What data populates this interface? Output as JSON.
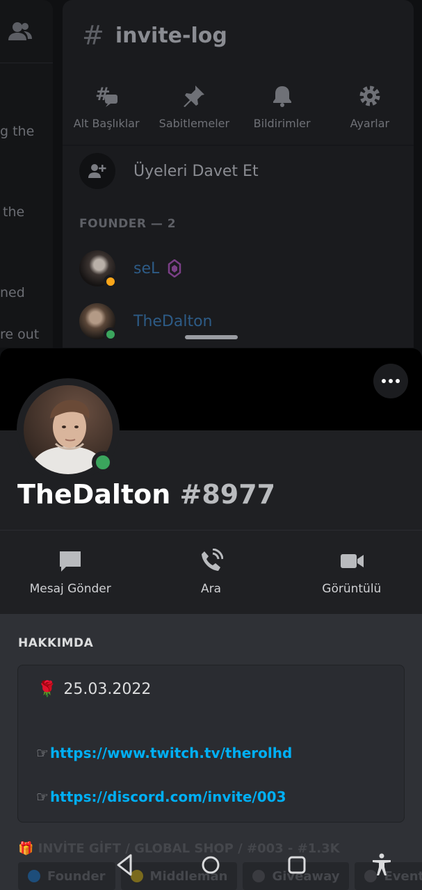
{
  "background": {
    "channel": {
      "name": "invite-log"
    },
    "tools": [
      {
        "icon": "threads-icon",
        "label": "Alt Başlıklar"
      },
      {
        "icon": "pin-icon",
        "label": "Sabitlemeler"
      },
      {
        "icon": "bell-icon",
        "label": "Bildirimler"
      },
      {
        "icon": "gear-icon",
        "label": "Ayarlar"
      }
    ],
    "invite_label": "Üyeleri Davet Et",
    "role_header": "FOUNDER — 2",
    "members": [
      {
        "name": "seL",
        "status_color": "#faa61a",
        "badge": "nitro-badge-icon"
      },
      {
        "name": "TheDalton",
        "status_color": "#3ba55d"
      }
    ],
    "chat_fragments": [
      "g the",
      "the",
      "ned",
      "re out"
    ]
  },
  "profile": {
    "username": "TheDalton",
    "discriminator": "#8977",
    "status": "online",
    "actions": [
      {
        "icon": "message-icon",
        "label": "Mesaj Gönder"
      },
      {
        "icon": "phone-icon",
        "label": "Ara"
      },
      {
        "icon": "video-icon",
        "label": "Görüntülü"
      }
    ],
    "about_header": "HAKKIMDA",
    "bio": {
      "date_emoji": "🌹",
      "date": "25.03.2022",
      "pointer": "☞",
      "links": [
        "https://www.twitch.tv/therolhd",
        "https://discord.com/invite/003"
      ]
    }
  },
  "underlay": {
    "server_line": "🎁 INVİTE GİFT / GLOBAL SHOP / #003 - #1.3K",
    "chips": [
      {
        "label": "Founder",
        "color": "#1d4d7a"
      },
      {
        "label": "Middleman",
        "color": "#7a6a1d"
      },
      {
        "label": "Giveaway",
        "color": "#3a3b40"
      },
      {
        "label": "Events",
        "color": "#3a3b40"
      }
    ]
  },
  "colors": {
    "accent_link": "#00aff4",
    "online": "#3ba55d",
    "idle": "#faa61a"
  }
}
